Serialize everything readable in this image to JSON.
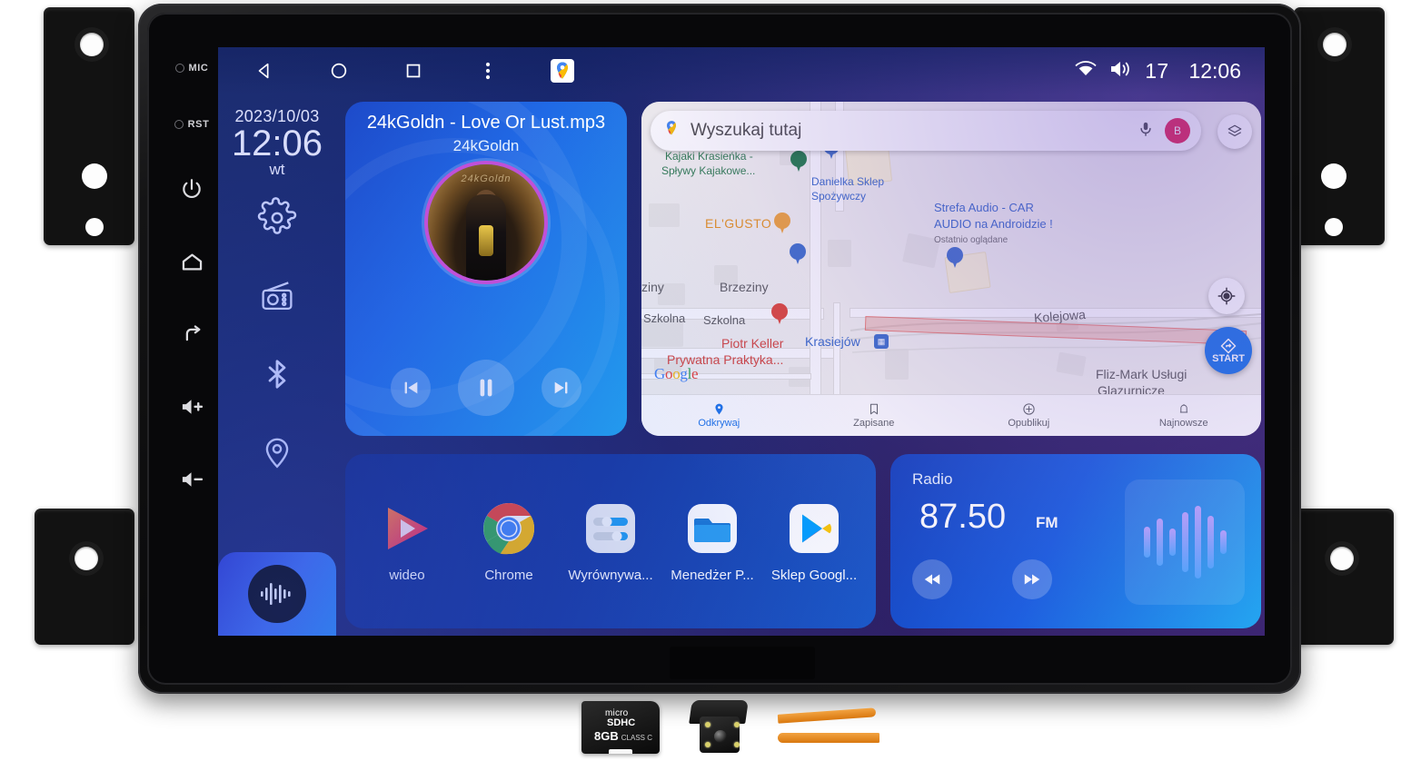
{
  "device": {
    "name": "android-car-head-unit",
    "hardware_keys": [
      {
        "id": "mic",
        "label": "MIC",
        "type": "led"
      },
      {
        "id": "rst",
        "label": "RST",
        "type": "led"
      },
      {
        "id": "power",
        "label": "",
        "icon": "power-icon"
      },
      {
        "id": "home",
        "label": "",
        "icon": "home-icon"
      },
      {
        "id": "back",
        "label": "",
        "icon": "back-arrow-icon"
      },
      {
        "id": "vol-up",
        "label": "",
        "icon": "volume-up-icon"
      },
      {
        "id": "vol-down",
        "label": "",
        "icon": "volume-down-icon"
      }
    ]
  },
  "statusbar": {
    "nav": [
      {
        "name": "back",
        "icon": "back-triangle-icon"
      },
      {
        "name": "home",
        "icon": "home-circle-icon"
      },
      {
        "name": "recents",
        "icon": "recents-square-icon"
      },
      {
        "name": "more",
        "icon": "overflow-menu-icon"
      },
      {
        "name": "maps-shortcut",
        "icon": "google-maps-icon"
      }
    ],
    "wifi_icon": "wifi-icon",
    "volume_icon": "volume-icon",
    "volume_value": "17",
    "clock": "12:06"
  },
  "left_panel": {
    "date": "2023/10/03",
    "time": "12:06",
    "day_of_week": "wt",
    "quick_icons": [
      {
        "name": "settings-icon",
        "label": "Settings"
      },
      {
        "name": "radio-icon",
        "label": "Radio"
      },
      {
        "name": "bluetooth-icon",
        "label": "Bluetooth"
      },
      {
        "name": "location-icon",
        "label": "Navigation"
      }
    ],
    "voice_button": {
      "icon": "voice-waveform-icon",
      "label": "Voice assistant"
    }
  },
  "music": {
    "title": "24kGoldn - Love Or Lust.mp3",
    "artist": "24kGoldn",
    "album_art_text": "24kGoldn",
    "controls": [
      {
        "name": "previous-track-button",
        "icon": "skip-previous-icon"
      },
      {
        "name": "play-pause-button",
        "icon": "pause-icon"
      },
      {
        "name": "next-track-button",
        "icon": "skip-next-icon"
      }
    ]
  },
  "map": {
    "search_placeholder": "Wyszukaj tutaj",
    "mic_icon": "microphone-icon",
    "avatar_initial": "B",
    "layers_icon": "map-layers-icon",
    "locate_icon": "my-location-icon",
    "start_button_label": "START",
    "attribution": "Google",
    "labels": [
      {
        "text": "Kajaki Krasieńka -",
        "color": "green"
      },
      {
        "text": "Spływy Kajakowe...",
        "color": "green"
      },
      {
        "text": "Danielka Sklep",
        "color": "blue"
      },
      {
        "text": "Spożywczy",
        "color": "blue"
      },
      {
        "text": "EL'GUSTO",
        "color": "orange"
      },
      {
        "text": "Strefa Audio - CAR",
        "color": "blue"
      },
      {
        "text": "AUDIO na Androidzie !",
        "color": "blue"
      },
      {
        "text": "Ostatnio oglądane",
        "color": "gray"
      },
      {
        "text": "Brzeziny",
        "color": "gray"
      },
      {
        "text": "ziny",
        "color": "gray"
      },
      {
        "text": "Szkolna",
        "color": "gray"
      },
      {
        "text": "Szkolna",
        "color": "gray"
      },
      {
        "text": "Piotr Keller",
        "color": "red"
      },
      {
        "text": "Prywatna Praktyka...",
        "color": "red"
      },
      {
        "text": "Krasiejów",
        "color": "blue"
      },
      {
        "text": "Kolejowa",
        "color": "gray"
      },
      {
        "text": "Fliz-Mark Usługi",
        "color": "gray"
      },
      {
        "text": "Glazurnicze",
        "color": "gray"
      }
    ],
    "bottom_nav": [
      {
        "label": "Odkrywaj",
        "icon": "explore-pin-icon",
        "active": true
      },
      {
        "label": "Zapisane",
        "icon": "bookmark-icon",
        "active": false
      },
      {
        "label": "Opublikuj",
        "icon": "plus-circle-icon",
        "active": false
      },
      {
        "label": "Najnowsze",
        "icon": "bell-icon",
        "active": false
      }
    ]
  },
  "apps": [
    {
      "label": "wideo",
      "icon": "video-player-icon"
    },
    {
      "label": "Chrome",
      "icon": "chrome-icon"
    },
    {
      "label": "Wyrównywa...",
      "icon": "equalizer-icon"
    },
    {
      "label": "Menedżer P...",
      "icon": "file-manager-icon"
    },
    {
      "label": "Sklep Googl...",
      "icon": "google-play-icon"
    }
  ],
  "radio": {
    "label": "Radio",
    "frequency": "87.50",
    "band": "FM",
    "prev_icon": "rewind-icon",
    "next_icon": "fast-forward-icon",
    "visualizer_bars": [
      34,
      52,
      30,
      66,
      80,
      58,
      26
    ]
  },
  "accessories": [
    {
      "name": "microsd-card",
      "brand_line1": "micro",
      "brand_line2": "SDHC",
      "capacity": "8GB",
      "class": "CLASS C"
    },
    {
      "name": "reversing-camera",
      "label": ""
    },
    {
      "name": "pry-tools",
      "label": ""
    }
  ],
  "colors": {
    "accent_blue": "#1a73e8",
    "card_blue": "#1b49c8",
    "screen_bg": "#1b2b6b",
    "avatar_pink": "#e4174e"
  }
}
